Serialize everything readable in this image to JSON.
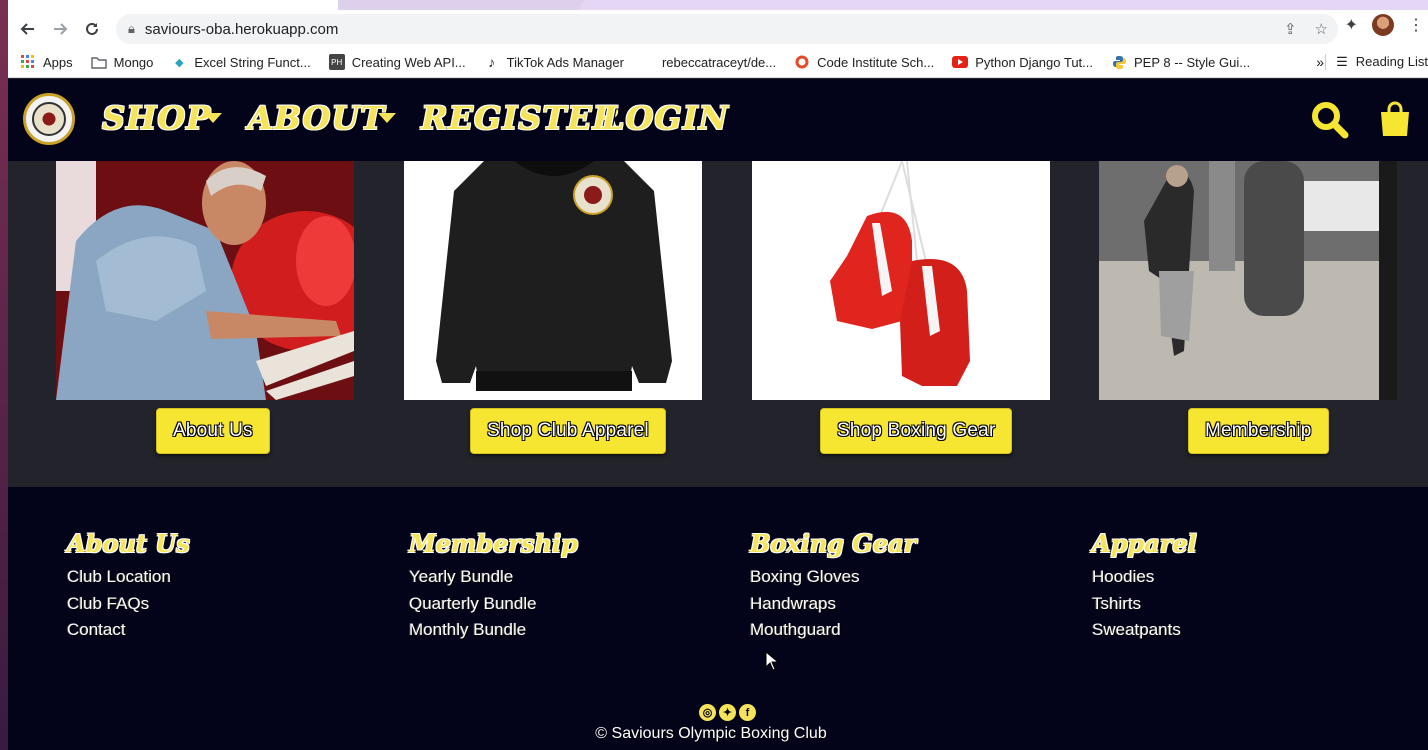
{
  "browser": {
    "url": "saviours-oba.herokuapp.com",
    "bookmarks": [
      {
        "label": "Apps",
        "icon": "apps-grid-icon"
      },
      {
        "label": "Mongo",
        "icon": "folder-icon"
      },
      {
        "label": "Excel String Funct...",
        "icon": "fish-icon"
      },
      {
        "label": "Creating Web API...",
        "icon": "ph-icon"
      },
      {
        "label": "TikTok Ads Manager",
        "icon": "tiktok-icon"
      },
      {
        "label": "rebeccatraceyt/de...",
        "icon": ""
      },
      {
        "label": "Code Institute Sch...",
        "icon": "ring-icon"
      },
      {
        "label": "Python Django Tut...",
        "icon": "youtube-icon"
      },
      {
        "label": "PEP 8 -- Style Gui...",
        "icon": "python-icon"
      }
    ],
    "more_label": "»",
    "reading_list": "Reading List"
  },
  "nav": {
    "shop": "SHOP",
    "about": "ABOUT",
    "register": "REGISTER",
    "login": "LOGIN"
  },
  "cards": [
    {
      "button": "About Us",
      "image": "coach-photo"
    },
    {
      "button": "Shop Club Apparel",
      "image": "hoodie-photo"
    },
    {
      "button": "Shop Boxing Gear",
      "image": "gloves-photo"
    },
    {
      "button": "Membership",
      "image": "gym-photo"
    }
  ],
  "footer": {
    "columns": [
      {
        "heading": "About Us",
        "links": [
          "Club Location",
          "Club FAQs",
          "Contact"
        ]
      },
      {
        "heading": "Membership",
        "links": [
          "Yearly Bundle",
          "Quarterly Bundle",
          "Monthly Bundle"
        ]
      },
      {
        "heading": "Boxing Gear",
        "links": [
          "Boxing Gloves",
          "Handwraps",
          "Mouthguard"
        ]
      },
      {
        "heading": "Apparel",
        "links": [
          "Hoodies",
          "Tshirts",
          "Sweatpants"
        ]
      }
    ],
    "copyright": "© Saviours Olympic Boxing Club"
  },
  "colors": {
    "nav_bg": "#03041a",
    "accent_yellow": "#f7e631",
    "content_bg": "#22232b"
  }
}
